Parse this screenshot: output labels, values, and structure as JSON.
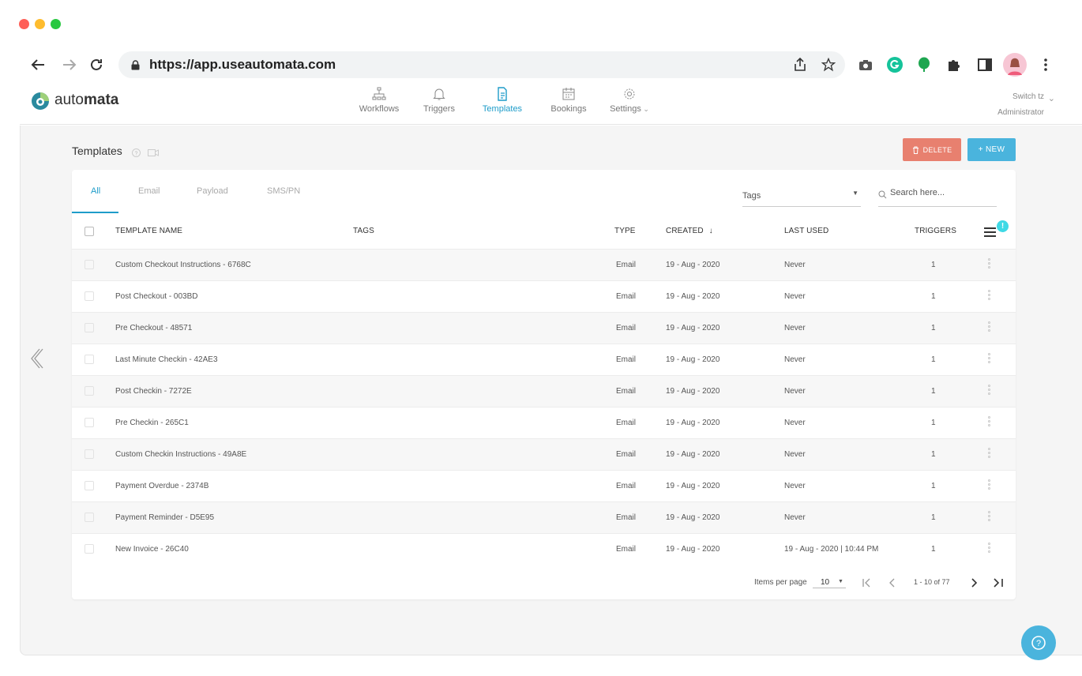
{
  "browser": {
    "url": "https://app.useautomata.com"
  },
  "app": {
    "logo_text_light": "auto",
    "logo_text_bold": "mata",
    "nav": [
      {
        "label": "Workflows",
        "icon": "sitemap-icon"
      },
      {
        "label": "Triggers",
        "icon": "bell-icon"
      },
      {
        "label": "Templates",
        "icon": "document-icon"
      },
      {
        "label": "Bookings",
        "icon": "calendar-icon"
      },
      {
        "label": "Settings",
        "icon": "gear-icon"
      }
    ],
    "active_nav": "Templates",
    "user": {
      "line1": "Switch tz",
      "line2": "Administrator"
    }
  },
  "page": {
    "title": "Templates",
    "delete_label": "DELETE",
    "new_label": "+ NEW",
    "tabs": [
      "All",
      "Email",
      "Payload",
      "SMS/PN"
    ],
    "active_tab": "All",
    "tags_placeholder": "Tags",
    "search_placeholder": "Search here...",
    "badge": "!"
  },
  "table": {
    "headers": {
      "name": "TEMPLATE NAME",
      "tags": "TAGS",
      "type": "TYPE",
      "created": "CREATED",
      "last_used": "LAST USED",
      "triggers": "TRIGGERS"
    },
    "rows": [
      {
        "name": "Custom Checkout Instructions - 6768C",
        "type": "Email",
        "created": "19 - Aug - 2020",
        "last_used": "Never",
        "triggers": "1"
      },
      {
        "name": "Post Checkout - 003BD",
        "type": "Email",
        "created": "19 - Aug - 2020",
        "last_used": "Never",
        "triggers": "1"
      },
      {
        "name": "Pre Checkout - 48571",
        "type": "Email",
        "created": "19 - Aug - 2020",
        "last_used": "Never",
        "triggers": "1"
      },
      {
        "name": "Last Minute Checkin - 42AE3",
        "type": "Email",
        "created": "19 - Aug - 2020",
        "last_used": "Never",
        "triggers": "1"
      },
      {
        "name": "Post Checkin - 7272E",
        "type": "Email",
        "created": "19 - Aug - 2020",
        "last_used": "Never",
        "triggers": "1"
      },
      {
        "name": "Pre Checkin - 265C1",
        "type": "Email",
        "created": "19 - Aug - 2020",
        "last_used": "Never",
        "triggers": "1"
      },
      {
        "name": "Custom Checkin Instructions - 49A8E",
        "type": "Email",
        "created": "19 - Aug - 2020",
        "last_used": "Never",
        "triggers": "1"
      },
      {
        "name": "Payment Overdue - 2374B",
        "type": "Email",
        "created": "19 - Aug - 2020",
        "last_used": "Never",
        "triggers": "1"
      },
      {
        "name": "Payment Reminder - D5E95",
        "type": "Email",
        "created": "19 - Aug - 2020",
        "last_used": "Never",
        "triggers": "1"
      },
      {
        "name": "New Invoice - 26C40",
        "type": "Email",
        "created": "19 - Aug - 2020",
        "last_used": "19 - Aug - 2020 | 10:44 PM",
        "triggers": "1"
      }
    ]
  },
  "pagination": {
    "items_per_page_label": "Items per page",
    "items_per_page_value": "10",
    "range": "1 - 10 of 77"
  },
  "colors": {
    "accent": "#1e9cc9",
    "delete": "#e8806f",
    "new": "#4ab4dd"
  }
}
